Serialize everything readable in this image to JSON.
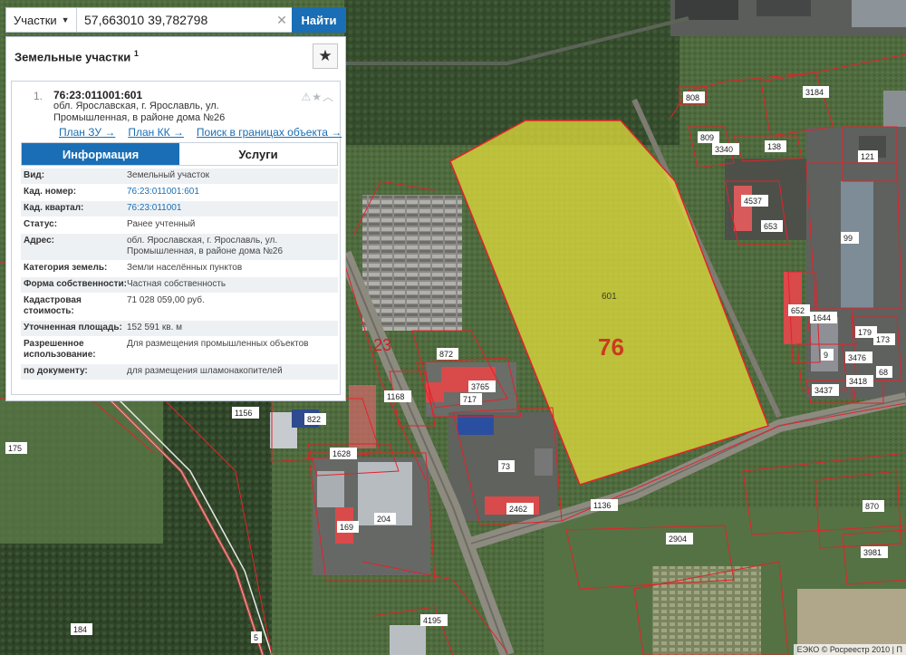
{
  "search": {
    "type_label": "Участки",
    "value": "57,663010 39,782798",
    "button_label": "Найти"
  },
  "panel": {
    "title": "Земельные участки",
    "count": "1"
  },
  "result": {
    "index": "1.",
    "cad_number": "76:23:011001:601",
    "address": "обл. Ярославская, г. Ярославль, ул. Промышленная, в районе дома №26",
    "links": [
      "План ЗУ →",
      "План КК →",
      "Поиск в границах объекта →"
    ],
    "tabs": [
      "Информация",
      "Услуги"
    ],
    "attributes": [
      {
        "label": "Вид:",
        "value": "Земельный участок"
      },
      {
        "label": "Кад. номер:",
        "value": "76:23:011001:601"
      },
      {
        "label": "Кад. квартал:",
        "value": "76:23:011001"
      },
      {
        "label": "Статус:",
        "value": "Ранее учтенный"
      },
      {
        "label": "Адрес:",
        "value": "обл. Ярославская, г. Ярославль, ул. Промышленная, в районе дома №26"
      },
      {
        "label": "Категория земель:",
        "value": "Земли населённых пунктов"
      },
      {
        "label": "Форма собственности:",
        "value": "Частная собственность"
      },
      {
        "label": "Кадастровая стоимость:",
        "value": "71 028 059,00 руб."
      },
      {
        "label": "Уточненная площадь:",
        "value": "152 591 кв. м"
      },
      {
        "label": "Разрешенное использование:",
        "value": "Для размещения промышленных объектов"
      },
      {
        "label": "по документу:",
        "value": "для размещения шламонакопителей"
      }
    ]
  },
  "map": {
    "highlight_color": "#e8e23a",
    "parcel_line_color": "#e4222a",
    "quarter_label": "76",
    "parcel_label": "601",
    "district_label": "23",
    "parcel_numbers": [
      "808",
      "3184",
      "809",
      "3340",
      "138",
      "121",
      "4537",
      "653",
      "99",
      "652",
      "1644",
      "179",
      "173",
      "9",
      "3476",
      "68",
      "3437",
      "3418",
      "872",
      "3765",
      "717",
      "1168",
      "1156",
      "822",
      "175",
      "1628",
      "73",
      "2462",
      "1136",
      "204",
      "169",
      "2904",
      "870",
      "3981",
      "184",
      "5",
      "4195"
    ],
    "attribution": "ЕЭКО © Росреестр 2010 | П"
  }
}
